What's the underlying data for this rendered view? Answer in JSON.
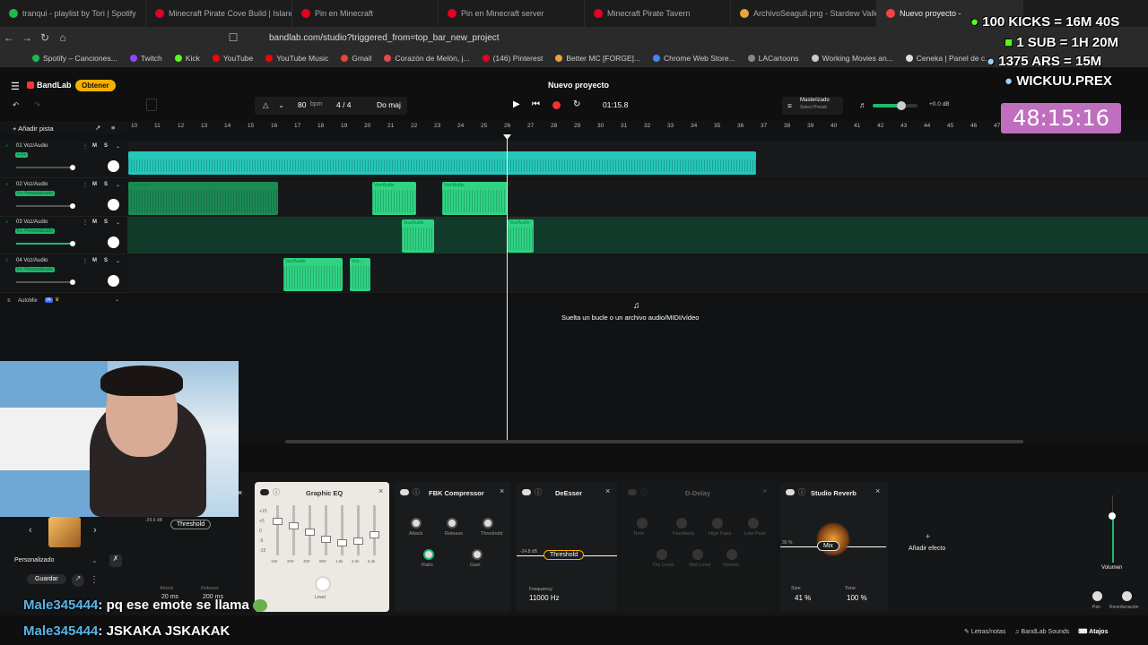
{
  "browser": {
    "tabs": [
      {
        "label": "tranqui - playlist by Tori | Spotify",
        "color": "#1db954",
        "active": false
      },
      {
        "label": "Minecraft Pirate Cove Build | Island",
        "color": "#e60023",
        "active": false
      },
      {
        "label": "Pin en Minecraft",
        "color": "#e60023",
        "active": false
      },
      {
        "label": "Pin en Minecraft server",
        "color": "#e60023",
        "active": false
      },
      {
        "label": "Minecraft Pirate Tavern",
        "color": "#e60023",
        "active": false
      },
      {
        "label": "ArchivoSeagull.png - Stardew Valle",
        "color": "#e8a33d",
        "active": false
      },
      {
        "label": "Nuevo proyecto -",
        "color": "#e44",
        "active": true
      }
    ],
    "url": "bandlab.com/studio?triggered_from=top_bar_new_project",
    "bookmarks": [
      "Spotify – Canciones...",
      "Twitch",
      "Kick",
      "YouTube",
      "YouTube Music",
      "Gmail",
      "Corazón de Melón, j...",
      "(146) Pinterest",
      "Better MC [FORGE]...",
      "Chrome Web Store...",
      "LACartoons",
      "Working Movies an...",
      "Ceneka | Panel de c..."
    ]
  },
  "bandlab": {
    "logo": "BandLab",
    "get_button": "Obtener",
    "project_title": "Nuevo proyecto",
    "bpm": "80",
    "bpm_unit": "bpm",
    "time_signature": "4 / 4",
    "key": "Do maj",
    "time": "01:15.8",
    "mastering_label": "Masterizado",
    "mastering_sub": "Select Preset",
    "volume_db": "+0.0 dB",
    "add_track": "Añadir pista",
    "automix": "AutoMix",
    "drop_hint": "Suelta un bucle o un archivo audio/MIDI/vídeo",
    "ruler_ticks": [
      "10",
      "11",
      "12",
      "13",
      "14",
      "15",
      "16",
      "17",
      "18",
      "19",
      "20",
      "21",
      "22",
      "23",
      "24",
      "25",
      "26",
      "27",
      "28",
      "29",
      "30",
      "31",
      "32",
      "33",
      "34",
      "35",
      "36",
      "37",
      "38",
      "39",
      "40",
      "41",
      "42",
      "43",
      "44",
      "45",
      "46",
      "47"
    ],
    "tracks": [
      {
        "name": "01 Voz/Audio",
        "fx": "+ Fx"
      },
      {
        "name": "02 Voz/Audio",
        "fx": "Fx: Personalizado"
      },
      {
        "name": "03 Voz/Audio",
        "fx": "Fx: Personalizado"
      },
      {
        "name": "04 Voz/Audio",
        "fx": "Fx: Personalizado"
      }
    ],
    "clip_label": "Voz/Audio",
    "clip_label_short": "Voz..."
  },
  "effects": {
    "preset": "Personalizado",
    "save": "Guardar",
    "threshold_label": "Threshold",
    "threshold_db": "-29.6 dB",
    "attack_label": "Attack",
    "attack_val": "20 ms",
    "release_label": "Release",
    "release_val": "200 ms",
    "graphic_eq": "Graphic EQ",
    "eq_bands": [
      "100",
      "200",
      "400",
      "800",
      "1.6k",
      "3.2k",
      "6.4k"
    ],
    "eq_scale": [
      "+15",
      "+5",
      "0",
      "-5",
      "-15"
    ],
    "level_label": "Level",
    "fbk": "FBK Compressor",
    "fbk_knobs": [
      "Attack",
      "Release",
      "Threshold",
      "Ratio",
      "Gain"
    ],
    "deesser": "DeEsser",
    "deesser_threshold": "Threshold",
    "deesser_db": "-24.8 dB",
    "frequency_label": "Frequency",
    "frequency_val": "11000 Hz",
    "ddelay": "D-Delay",
    "ddelay_knobs": [
      "Time",
      "Feedback",
      "High Pass",
      "Low Pass",
      "Dry Level",
      "Wet Level",
      "Volume"
    ],
    "reverb": "Studio Reverb",
    "mix_label": "Mix",
    "mix_pct": "30 %",
    "size_label": "Size",
    "size_val": "41 %",
    "tone_label": "Tone",
    "tone_val": "100 %",
    "add_effect": "Añadir efecto",
    "volume_label": "Volumen",
    "pan_label": "Pan",
    "reverb_label": "Reverberación"
  },
  "bottom": {
    "lyrics": "Letras/notas",
    "sounds": "BandLab Sounds",
    "shortcuts": "Atajos"
  },
  "chat": [
    {
      "user": "Male345444",
      "msg": ": pq ese emote se llama"
    },
    {
      "user": "Male345444",
      "msg": ": JSKAKA JSKAKAK"
    }
  ],
  "stream_overlay": {
    "lines": [
      "100 KICKS = 16M 40S",
      "1 SUB = 1H 20M",
      "1375 ARS = 15M",
      "WICKUU.PREX"
    ],
    "timer": "48:15:16"
  }
}
